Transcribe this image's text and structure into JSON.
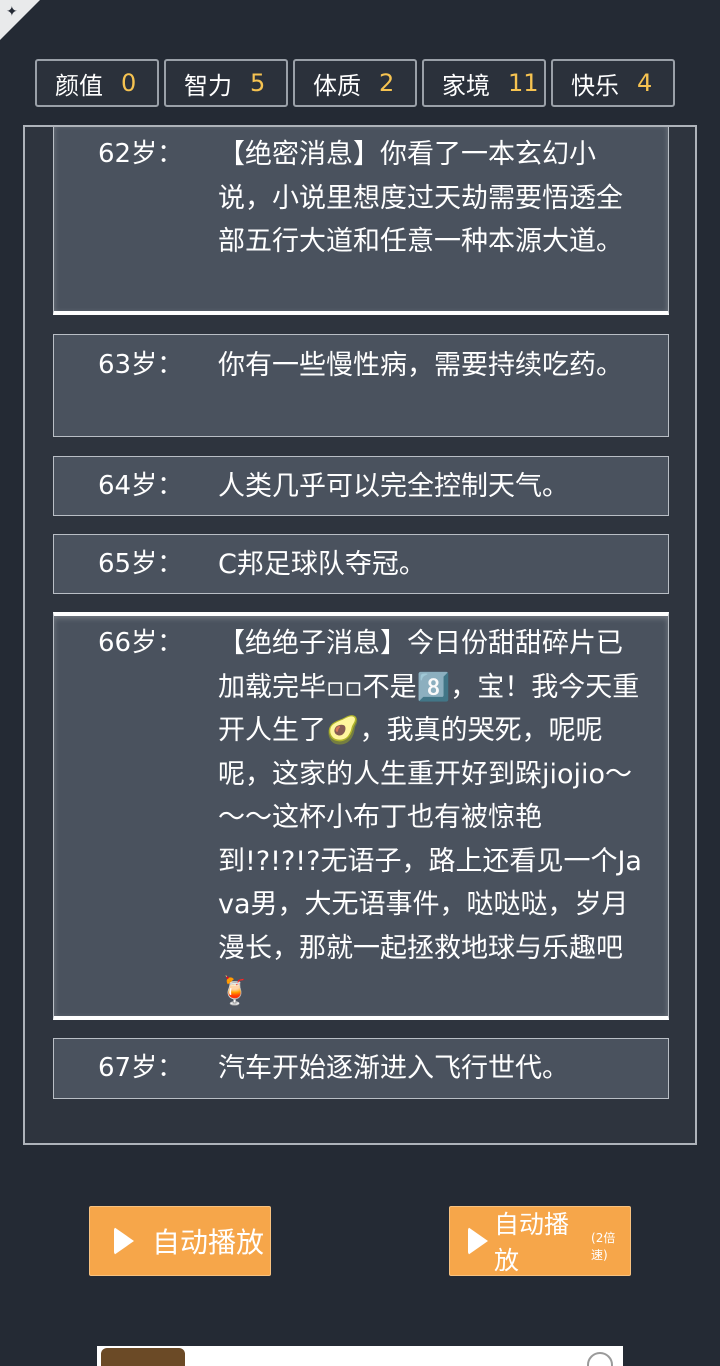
{
  "stats": [
    {
      "label": "颜值",
      "value": "0"
    },
    {
      "label": "智力",
      "value": "5"
    },
    {
      "label": "体质",
      "value": "2"
    },
    {
      "label": "家境",
      "value": "11"
    },
    {
      "label": "快乐",
      "value": "4"
    }
  ],
  "log": [
    {
      "age": "62岁：",
      "text": "【绝密消息】你看了一本玄幻小说，小说里想度过天劫需要悟透全部五行大道和任意一种本源大道。"
    },
    {
      "age": "63岁：",
      "text": "你有一些慢性病，需要持续吃药。"
    },
    {
      "age": "64岁：",
      "text": "人类几乎可以完全控制天气。"
    },
    {
      "age": "65岁：",
      "text": "C邦足球队夺冠。"
    },
    {
      "age": "66岁：",
      "text": "【绝绝子消息】今日份甜甜碎片已加载完毕▫▫不是8️⃣，宝！我今天重开人生了🥑，我真的哭死，呢呢呢，这家的人生重开好到跺jiojio～～～这杯小布丁也有被惊艳到!?!?!?无语子，路上还看见一个Java男，大无语事件，哒哒哒，岁月漫长，那就一起拯救地球与乐趣吧🍹"
    },
    {
      "age": "67岁：",
      "text": "汽车开始逐渐进入飞行世代。"
    }
  ],
  "buttons": {
    "auto_play": "自动播放",
    "auto_play_2x": "自动播放",
    "auto_play_2x_suffix": "(2倍速)"
  },
  "colors": {
    "background": "#242a34",
    "entry_bg": "#4a525e",
    "stat_value": "#f6c351",
    "button": "#f6a64a"
  }
}
